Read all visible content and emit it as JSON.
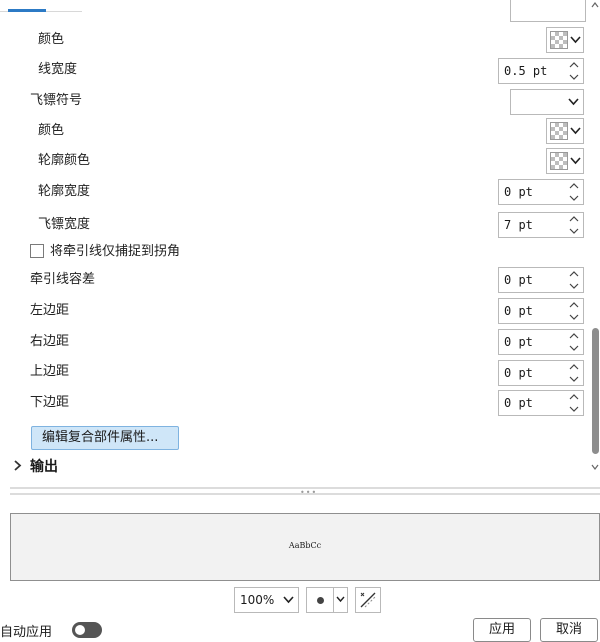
{
  "properties": {
    "color_1": "颜色",
    "line_width": "线宽度",
    "line_width_value": "0.5 pt",
    "dart_symbol": "飞镖符号",
    "color_2": "颜色",
    "outline_color": "轮廓颜色",
    "outline_width": "轮廓宽度",
    "outline_width_value": "0 pt",
    "dart_width": "飞镖宽度",
    "dart_width_value": "7 pt",
    "snap_checkbox": "将牵引线仅捕捉到拐角",
    "leader_tolerance": "牵引线容差",
    "leader_tolerance_value": "0 pt",
    "left_margin": "左边距",
    "left_margin_value": "0 pt",
    "right_margin": "右边距",
    "right_margin_value": "0 pt",
    "top_margin": "上边距",
    "top_margin_value": "0 pt",
    "bottom_margin": "下边距",
    "bottom_margin_value": "0 pt",
    "edit_composite_button": "编辑复合部件属性..."
  },
  "sections": {
    "output": "输出"
  },
  "preview": {
    "sample_text": "AaBbCc"
  },
  "footer": {
    "zoom_value": "100%",
    "auto_apply": "自动应用",
    "apply_button": "应用",
    "cancel_button": "取消"
  },
  "colors": {
    "accent": "#2c7ac5",
    "button_highlight": "#cfe6f8",
    "toggle_off": "#555555"
  }
}
